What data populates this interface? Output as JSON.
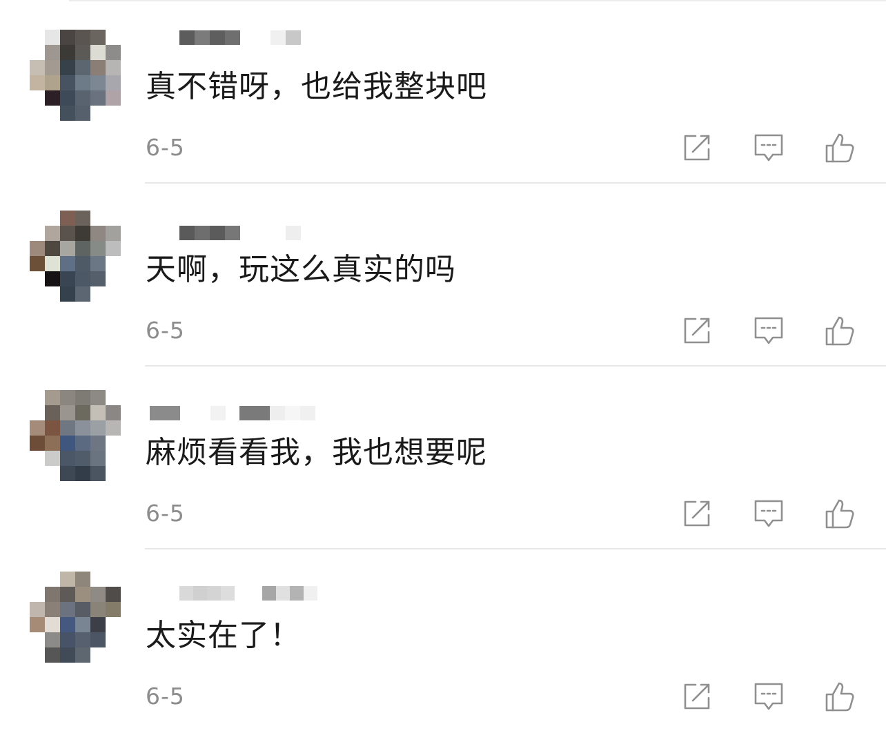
{
  "comments": [
    {
      "text": "真不错呀，也给我整块吧",
      "date": "6-5"
    },
    {
      "text": "天啊，玩这么真实的吗",
      "date": "6-5"
    },
    {
      "text": "麻烦看看我，我也想要呢",
      "date": "6-5"
    },
    {
      "text": "太实在了！",
      "date": "6-5"
    }
  ],
  "icons": {
    "share": "share-icon",
    "reply": "comment-icon",
    "like": "thumbs-up-icon"
  },
  "colors": {
    "text": "#1a1a1a",
    "date": "#8c8c8c",
    "icon": "#8f8f8f",
    "divider": "#e8e8e8"
  }
}
